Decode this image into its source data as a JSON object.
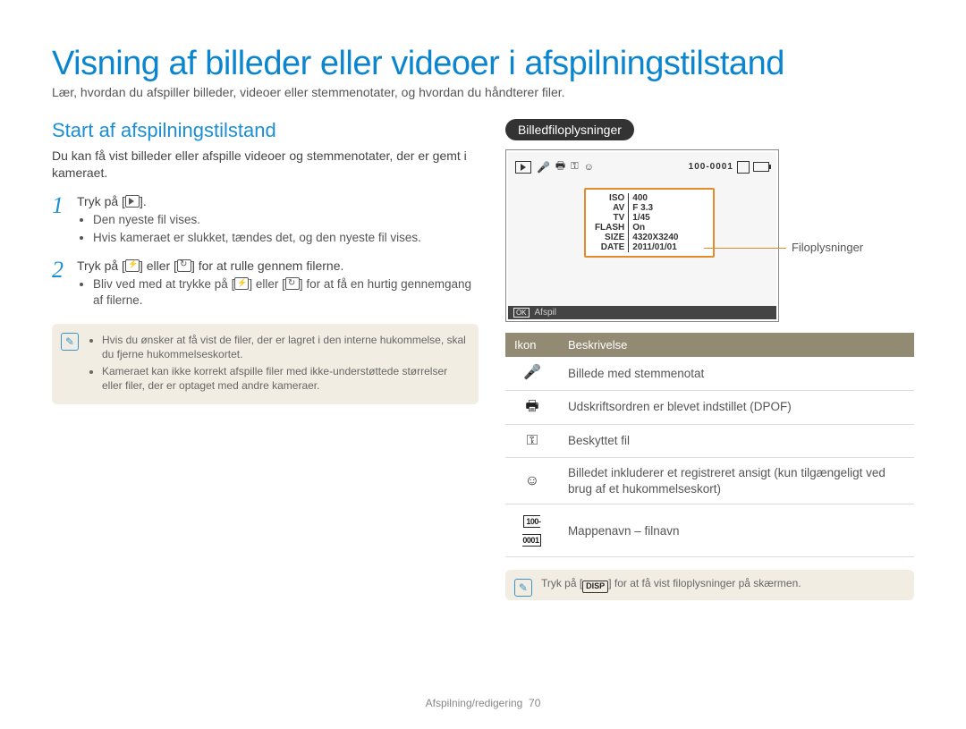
{
  "title": "Visning af billeder eller videoer i afspilningstilstand",
  "subtitle": "Lær, hvordan du afspiller billeder, videoer eller stemmenotater, og hvordan du håndterer filer.",
  "left": {
    "sectionTitle": "Start af afspilningstilstand",
    "intro": "Du kan få vist billeder eller afspille videoer og stemmenotater, der er gemt i kameraet.",
    "step1": {
      "num": "1",
      "pre": "Tryk på [",
      "post": "].",
      "b1": "Den nyeste fil vises.",
      "b2": "Hvis kameraet er slukket, tændes det, og den nyeste fil vises."
    },
    "step2": {
      "num": "2",
      "pre": "Tryk på [",
      "mid": "] eller [",
      "post": "] for at rulle gennem filerne.",
      "b1a": "Bliv ved med at trykke på [",
      "b1b": "] eller [",
      "b1c": "] for at få en hurtig gennemgang af filerne."
    },
    "note": {
      "i1": "Hvis du ønsker at få vist de filer, der er lagret i den interne hukommelse, skal du fjerne hukommelseskortet.",
      "i2": "Kameraet kan ikke korrekt afspille filer med ikke-understøttede størrelser eller filer, der er optaget med andre kameraer."
    }
  },
  "right": {
    "pill": "Billedfiloplysninger",
    "screen": {
      "folder": "100-0001",
      "info": {
        "ISO": "400",
        "AV": "F 3.3",
        "TV": "1/45",
        "FLASH": "On",
        "SIZE": "4320X3240",
        "DATE": "2011/01/01"
      },
      "ok": "OK",
      "afspil": "Afspil"
    },
    "callout": "Filoplysninger",
    "table": {
      "h1": "Ikon",
      "h2": "Beskrivelse",
      "r1": "Billede med stemmenotat",
      "r2": "Udskriftsordren er blevet indstillet (DPOF)",
      "r3": "Beskyttet fil",
      "r4": "Billedet inkluderer et registreret ansigt (kun tilgængeligt ved brug af et hukommelseskort)",
      "r5": "Mappenavn – filnavn",
      "r5icon": "100-0001"
    },
    "note2a": "Tryk på [",
    "note2disp": "DISP",
    "note2b": "] for at få vist filoplysninger på skærmen."
  },
  "footer": {
    "section": "Afspilning/redigering",
    "page": "70"
  }
}
